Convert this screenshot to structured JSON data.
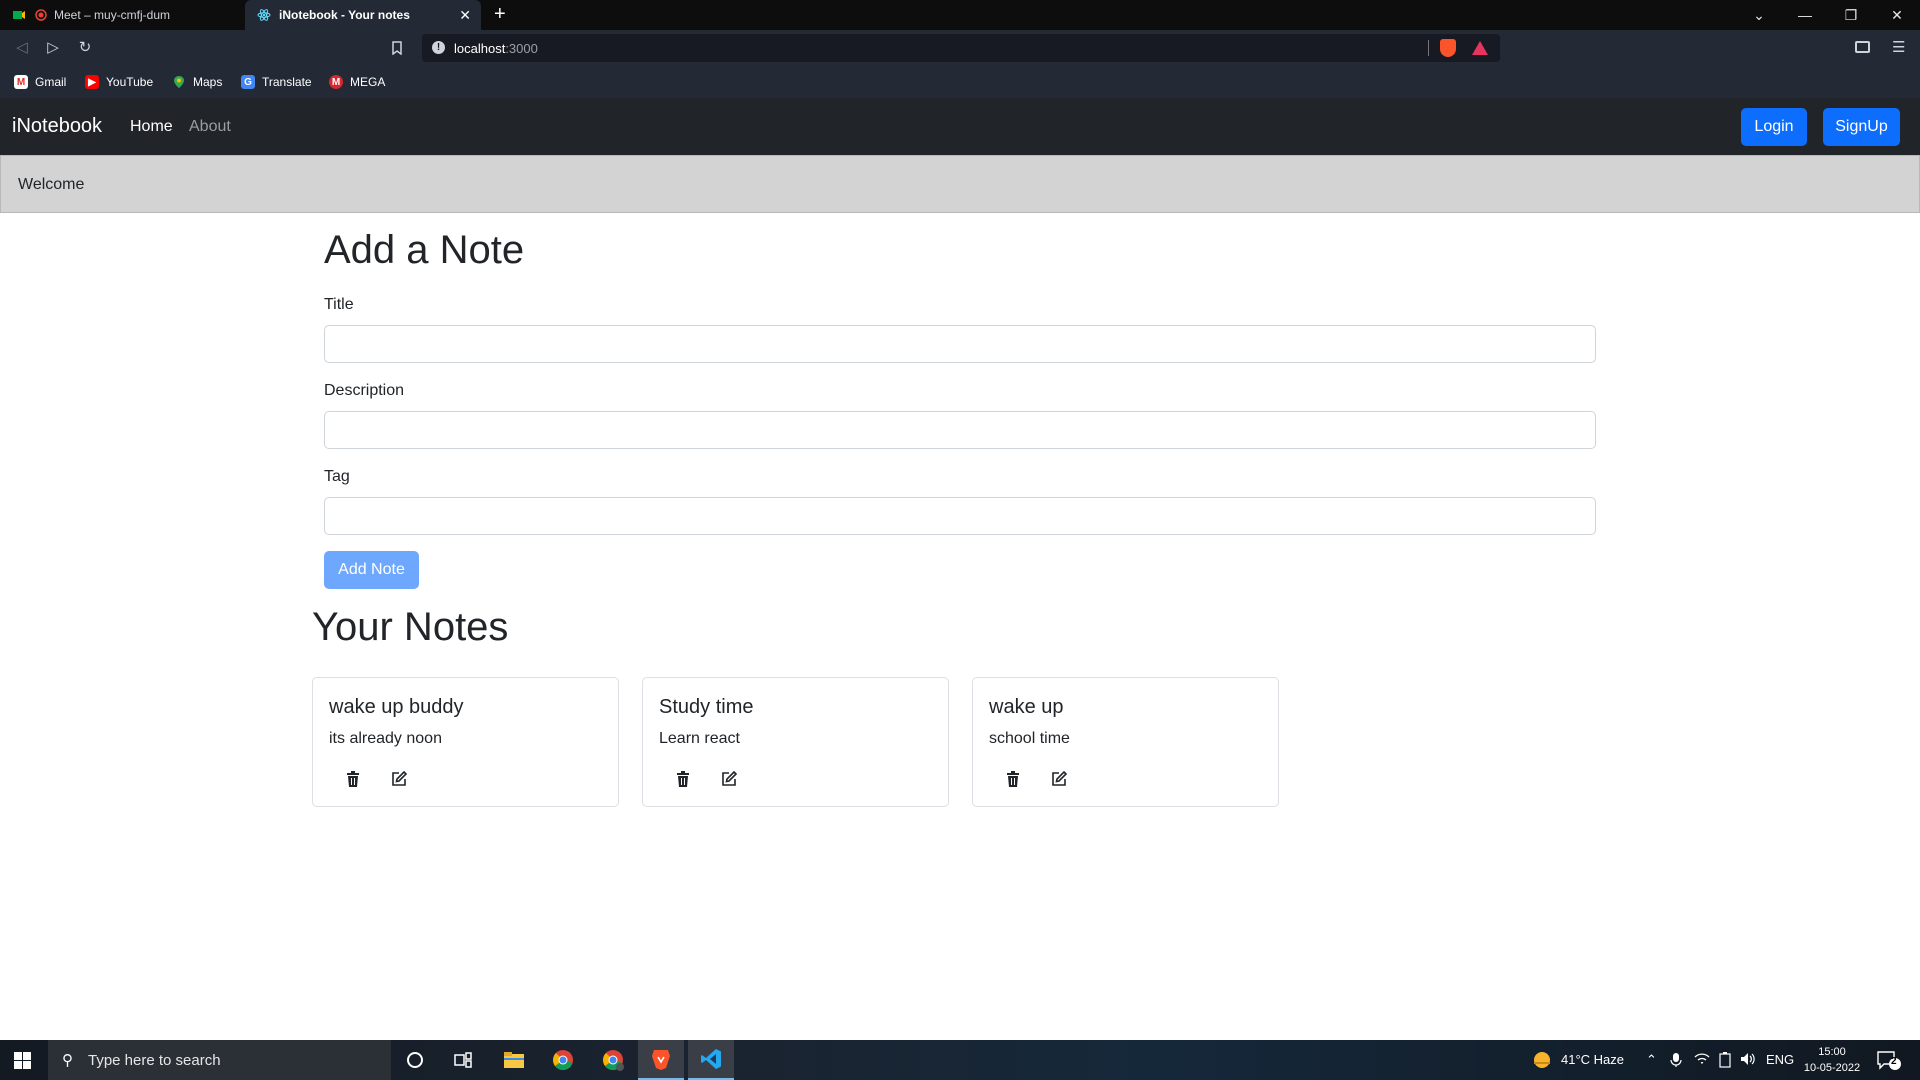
{
  "browser": {
    "tabs": [
      {
        "title": "Meet – muy-cmfj-dum",
        "active": false
      },
      {
        "title": "iNotebook - Your notes",
        "active": true
      }
    ],
    "url_host": "localhost",
    "url_port": ":3000",
    "bookmarks": [
      {
        "label": "Gmail",
        "icon": "gmail-icon",
        "color": "#d93025"
      },
      {
        "label": "YouTube",
        "icon": "youtube-icon",
        "color": "#ff0000"
      },
      {
        "label": "Maps",
        "icon": "maps-icon",
        "color": "#34a853"
      },
      {
        "label": "Translate",
        "icon": "translate-icon",
        "color": "#4285f4"
      },
      {
        "label": "MEGA",
        "icon": "mega-icon",
        "color": "#d9272e"
      }
    ]
  },
  "app": {
    "brand": "iNotebook",
    "nav": {
      "home": "Home",
      "about": "About"
    },
    "login_label": "Login",
    "signup_label": "SignUp",
    "alert": "Welcome",
    "add_heading": "Add a Note",
    "form": {
      "title_label": "Title",
      "description_label": "Description",
      "tag_label": "Tag",
      "submit_label": "Add Note"
    },
    "notes_heading": "Your Notes",
    "notes": [
      {
        "title": "wake up buddy",
        "description": "its already noon"
      },
      {
        "title": "Study time",
        "description": "Learn react"
      },
      {
        "title": "wake up",
        "description": "school time"
      }
    ],
    "colors": {
      "primary": "#0d6efd",
      "primary_disabled": "#6ea8fe",
      "navbar": "#212529",
      "alert": "#d3d3d3"
    }
  },
  "taskbar": {
    "search_placeholder": "Type here to search",
    "weather": "41°C  Haze",
    "language": "ENG",
    "time": "15:00",
    "date": "10-05-2022",
    "notifications": "2"
  }
}
